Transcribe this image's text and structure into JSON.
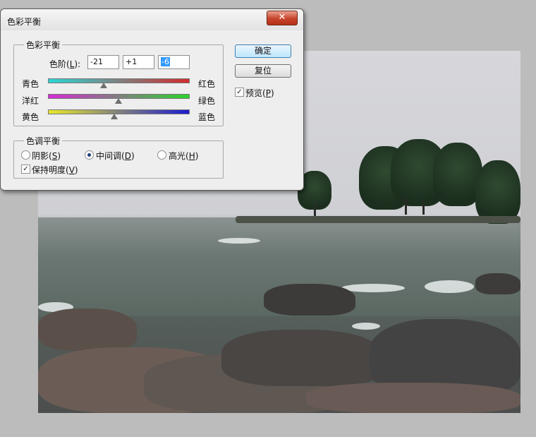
{
  "dialog": {
    "title": "色彩平衡",
    "close_label": "✕",
    "color_balance": {
      "legend": "色彩平衡",
      "levels_label": "色阶(L):",
      "levels": [
        "-21",
        "+1",
        "-6"
      ],
      "sliders": [
        {
          "left": "青色",
          "right": "红色",
          "value": -21,
          "colors": [
            "#2ad7d7",
            "#d42b2b"
          ]
        },
        {
          "left": "洋红",
          "right": "绿色",
          "value": 1,
          "colors": [
            "#d62ad6",
            "#2bd42b"
          ]
        },
        {
          "left": "黄色",
          "right": "蓝色",
          "value": -6,
          "colors": [
            "#e8e82a",
            "#1b1bd2"
          ]
        }
      ]
    },
    "tone_balance": {
      "legend": "色调平衡",
      "options": [
        {
          "label": "阴影(S)",
          "checked": false
        },
        {
          "label": "中间调(D)",
          "checked": true
        },
        {
          "label": "高光(H)",
          "checked": false
        }
      ],
      "preserve_luminosity": {
        "label": "保持明度(V)",
        "checked": true
      }
    },
    "buttons": {
      "ok": "确定",
      "reset": "复位"
    },
    "preview": {
      "label": "预览(P)",
      "checked": true
    }
  }
}
